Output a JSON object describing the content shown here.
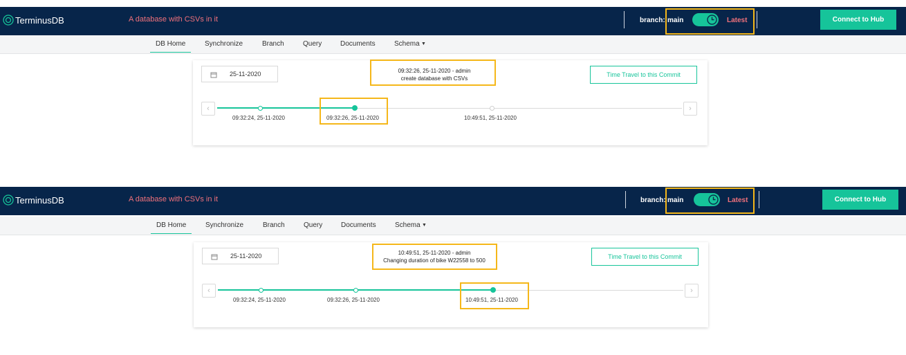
{
  "colors": {
    "navy": "#07254a",
    "accent": "#16c49a",
    "pink": "#f0717b",
    "highlight": "#f5b719"
  },
  "icons": [
    "terminusdb-logo-icon",
    "clock-icon",
    "calendar-icon",
    "chevron-left-icon",
    "chevron-right-icon",
    "caret-down-icon"
  ],
  "panels": [
    {
      "header": {
        "brand": "TerminusDB",
        "db_title": "A database with CSVs in it",
        "branch_label": "branch:",
        "branch_name": "main",
        "latest_label": "Latest",
        "hub_button": "Connect to Hub"
      },
      "nav": {
        "tabs": [
          "DB Home",
          "Synchronize",
          "Branch",
          "Query",
          "Documents",
          "Schema"
        ],
        "active": "DB Home"
      },
      "timeline": {
        "date": "25-11-2020",
        "commit_info": {
          "line1": "09:32:26, 25-11-2020 - admin",
          "line2": "create database with CSVs"
        },
        "time_travel_button": "Time Travel to this Commit",
        "commits": [
          "09:32:24, 25-11-2020",
          "09:32:26, 25-11-2020",
          "10:49:51, 25-11-2020"
        ],
        "selected_index": 1
      }
    },
    {
      "header": {
        "brand": "TerminusDB",
        "db_title": "A database with CSVs in it",
        "branch_label": "branch:",
        "branch_name": "main",
        "latest_label": "Latest",
        "hub_button": "Connect to Hub"
      },
      "nav": {
        "tabs": [
          "DB Home",
          "Synchronize",
          "Branch",
          "Query",
          "Documents",
          "Schema"
        ],
        "active": "DB Home"
      },
      "timeline": {
        "date": "25-11-2020",
        "commit_info": {
          "line1": "10:49:51, 25-11-2020 - admin",
          "line2": "Changing duration of bike W22558 to 500"
        },
        "time_travel_button": "Time Travel to this Commit",
        "commits": [
          "09:32:24, 25-11-2020",
          "09:32:26, 25-11-2020",
          "10:49:51, 25-11-2020"
        ],
        "selected_index": 2
      }
    }
  ]
}
